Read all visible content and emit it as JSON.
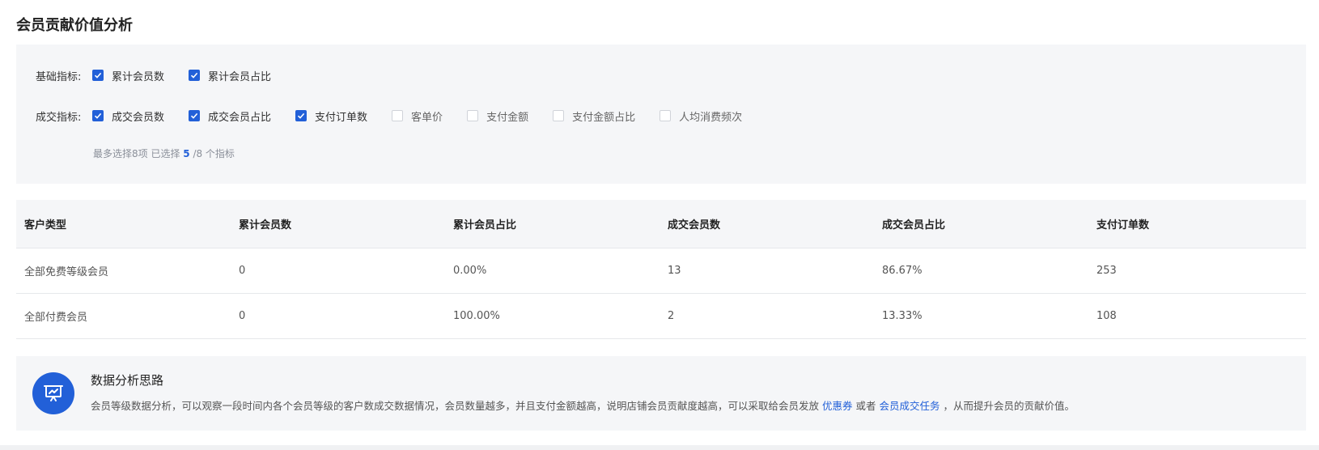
{
  "page": {
    "title": "会员贡献价值分析"
  },
  "filters": {
    "basic": {
      "label": "基础指标:",
      "options": [
        {
          "label": "累计会员数",
          "checked": true
        },
        {
          "label": "累计会员占比",
          "checked": true
        }
      ]
    },
    "deal": {
      "label": "成交指标:",
      "options": [
        {
          "label": "成交会员数",
          "checked": true
        },
        {
          "label": "成交会员占比",
          "checked": true
        },
        {
          "label": "支付订单数",
          "checked": true
        },
        {
          "label": "客单价",
          "checked": false
        },
        {
          "label": "支付金额",
          "checked": false
        },
        {
          "label": "支付金额占比",
          "checked": false
        },
        {
          "label": "人均消费频次",
          "checked": false
        }
      ]
    },
    "hint": {
      "prefix": "最多选择8项 已选择 ",
      "count": "5",
      "suffix": " /8 个指标"
    }
  },
  "table": {
    "headers": [
      "客户类型",
      "累计会员数",
      "累计会员占比",
      "成交会员数",
      "成交会员占比",
      "支付订单数"
    ],
    "rows": [
      [
        "全部免费等级会员",
        "0",
        "0.00%",
        "13",
        "86.67%",
        "253"
      ],
      [
        "全部付费会员",
        "0",
        "100.00%",
        "2",
        "13.33%",
        "108"
      ]
    ]
  },
  "info": {
    "icon": "presentation-chart-icon",
    "title": "数据分析思路",
    "text_before": "会员等级数据分析，可以观察一段时间内各个会员等级的客户数成交数据情况，会员数量越多，并且支付金额越高，说明店铺会员贡献度越高，可以采取给会员发放 ",
    "link1": "优惠券",
    "text_middle": " 或者 ",
    "link2": "会员成交任务",
    "text_after": " ，从而提升会员的贡献价值。"
  },
  "colors": {
    "accent": "#2260d8",
    "panel_bg": "#f5f6f8",
    "border": "#e6e8eb"
  }
}
